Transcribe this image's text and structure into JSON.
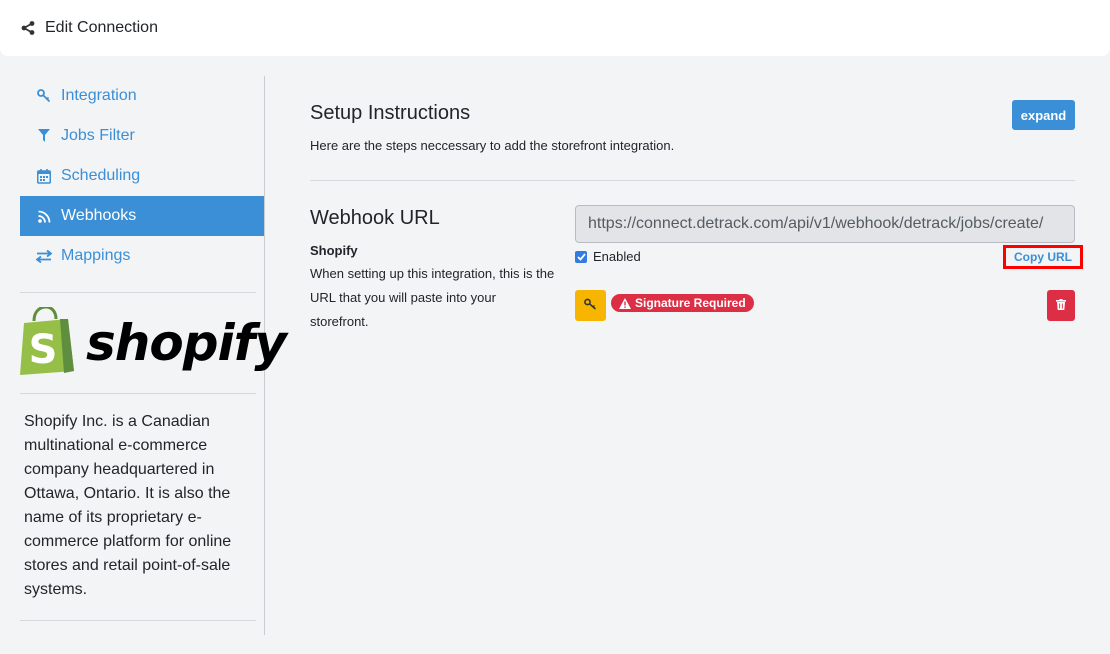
{
  "header": {
    "title": "Edit Connection",
    "icon": "share-icon"
  },
  "sidebar": {
    "items": [
      {
        "label": "Integration",
        "icon": "key-icon",
        "active": false
      },
      {
        "label": "Jobs Filter",
        "icon": "filter-icon",
        "active": false
      },
      {
        "label": "Scheduling",
        "icon": "calendar-icon",
        "active": false
      },
      {
        "label": "Webhooks",
        "icon": "rss-icon",
        "active": true
      },
      {
        "label": "Mappings",
        "icon": "exchange-icon",
        "active": false
      }
    ],
    "logo": {
      "text": "shopify",
      "icon": "shopify-bag-icon"
    },
    "description": "Shopify Inc. is a Canadian multinational e-commerce company headquartered in Ottawa, Ontario. It is also the name of its proprietary e-commerce platform for online stores and retail point-of-sale systems."
  },
  "setup": {
    "title": "Setup Instructions",
    "subtitle": "Here are the steps neccessary to add the storefront integration.",
    "expand_label": "expand"
  },
  "webhook": {
    "title": "Webhook URL",
    "platform": "Shopify",
    "description": "When setting up this integration, this is the URL that you will paste into your storefront.",
    "url": "https://connect.detrack.com/api/v1/webhook/detrack/jobs/create/",
    "enabled_label": "Enabled",
    "enabled": true,
    "copy_label": "Copy URL",
    "signature_badge": "Signature Required"
  },
  "colors": {
    "accent": "#3a8fd6",
    "danger": "#dc2f45",
    "warning": "#f7b500"
  }
}
